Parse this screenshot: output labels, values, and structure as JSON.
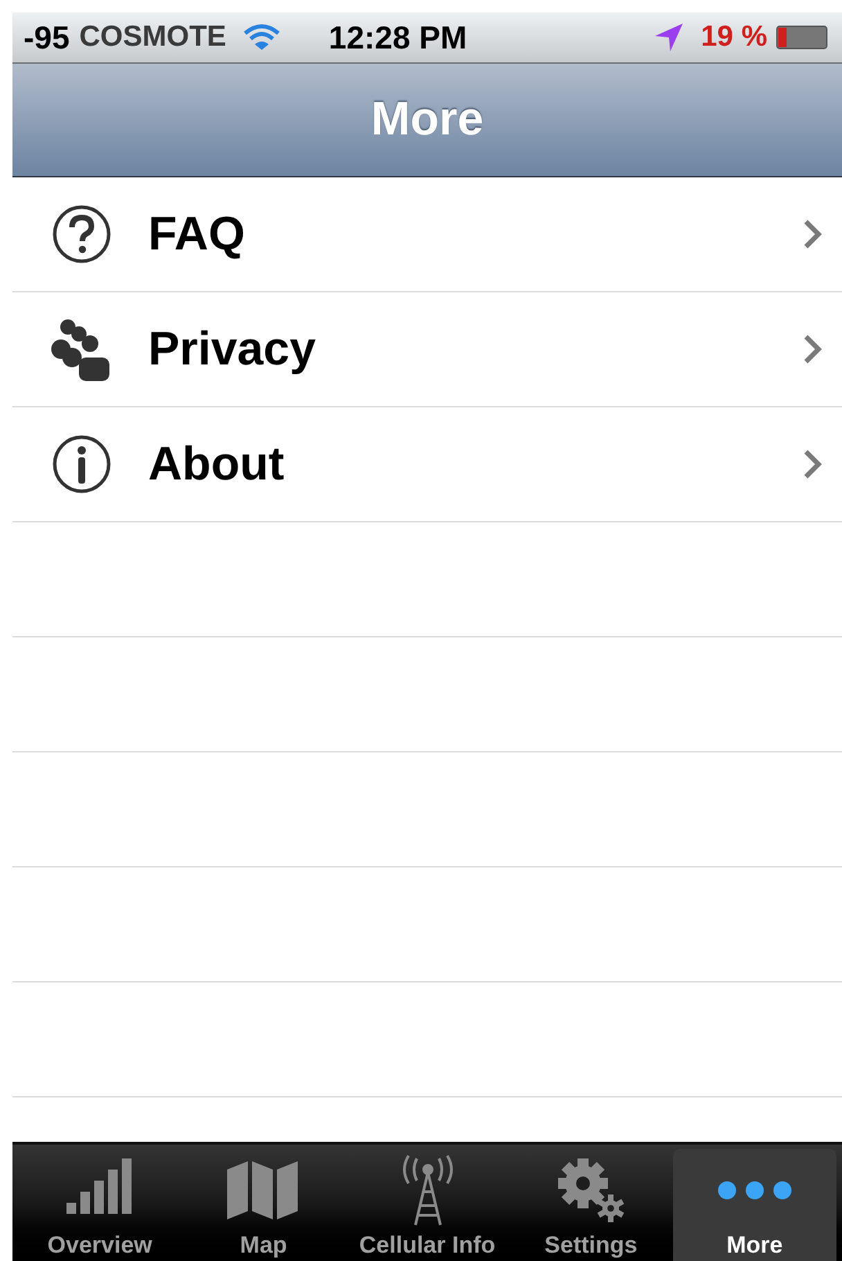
{
  "status_bar": {
    "signal": "-95",
    "carrier": "COSMOTE",
    "time": "12:28 PM",
    "battery": "19 %"
  },
  "nav_bar": {
    "title": "More"
  },
  "menu_items": [
    {
      "label": "FAQ",
      "kind": "question"
    },
    {
      "label": "Privacy",
      "kind": "people"
    },
    {
      "label": "About",
      "kind": "info"
    }
  ],
  "tab_bar": [
    {
      "label": "Overview",
      "kind": "bars",
      "selected": false
    },
    {
      "label": "Map",
      "kind": "map",
      "selected": false
    },
    {
      "label": "Cellular Info",
      "kind": "tower",
      "selected": false
    },
    {
      "label": "Settings",
      "kind": "gear",
      "selected": false
    },
    {
      "label": "More",
      "kind": "dots",
      "selected": true
    }
  ]
}
